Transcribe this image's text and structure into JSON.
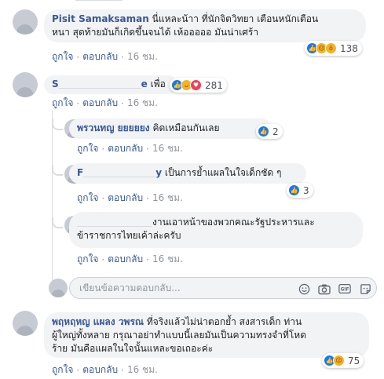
{
  "comments": [
    {
      "name": "Pisit Samaksaman",
      "text": "นี่แหละน้าา ที่นักจิตวิทยา เตือนหนักเตือนหนา สุดท้ายมันก็เกิดขึ้นจนได้ เห้อออออ มันน่าเศร้า",
      "line1": "นี่แหละน้าา ที่นักจิตวิทยา เตือนหนักเตือน",
      "line2": "หนา สุดท้ายมันก็เกิดขึ้นจนได้ เห้อออออ มันน่าเศร้า",
      "reactions": [
        "like",
        "sad",
        "wow"
      ],
      "reaction_count": "138",
      "like_label": "ถูกใจ",
      "reply_label": "ตอบกลับ",
      "time": "16 ชม."
    },
    {
      "name": "S",
      "name_tail": "e",
      "text": "เพื่อ",
      "reactions": [
        "like",
        "haha",
        "love"
      ],
      "reaction_count": "281",
      "like_label": "ถูกใจ",
      "reply_label": "ตอบกลับ",
      "time": "16 ชม."
    }
  ],
  "replies": [
    {
      "name": "พรวนทญ ยยยยยง",
      "text": "คิดเหมือนกันเลย",
      "reactions": [
        "like"
      ],
      "reaction_count": "2",
      "like_label": "ถูกใจ",
      "reply_label": "ตอบกลับ",
      "time": "16 ชม."
    },
    {
      "name": "F",
      "name_tail": "y",
      "text": "เป็นการย้ำแผลในใจเด็กชัด ๆ",
      "reactions": [
        "like"
      ],
      "reaction_count": "3",
      "like_label": "ถูกใจ",
      "reply_label": "ตอบกลับ",
      "time": "16 ชม."
    },
    {
      "line1": "งานเอาหน้าของพวกคณะรัฐประหารและ",
      "line2": "ข้าราชการไทยเค้าล่ะครับ",
      "like_label": "ถูกใจ",
      "reply_label": "ตอบกลับ",
      "time": "16 ชม."
    }
  ],
  "reply_box": {
    "placeholder": "เขียนข้อความตอบกลับ...",
    "icons": [
      "smiley-icon",
      "camera-icon",
      "gif-icon",
      "sticker-icon"
    ]
  },
  "comment3": {
    "name": "พฤหฤหญ แผลง วพรณ",
    "line1": "ที่จริงแล้วไม่น่าตอกย้ำ สงสารเด็ก ท่าน",
    "line2": "ผู้ใหญ่ทั้งหลาย กรุณาอย่าทำแบบนี้เลยมันเป็นความทรงจำที่โหด",
    "line3": "ร้าย มันคือแผลในใจนั้นแหละขอเถอะค่ะ",
    "reactions": [
      "like",
      "sad"
    ],
    "reaction_count": "75",
    "like_label": "ถูกใจ",
    "reply_label": "ตอบกลับ",
    "time": "16 ชม."
  },
  "colors": {
    "link": "#385898",
    "bubble": "#f2f3f5",
    "meta": "#90949c",
    "like": "#1877f2"
  }
}
